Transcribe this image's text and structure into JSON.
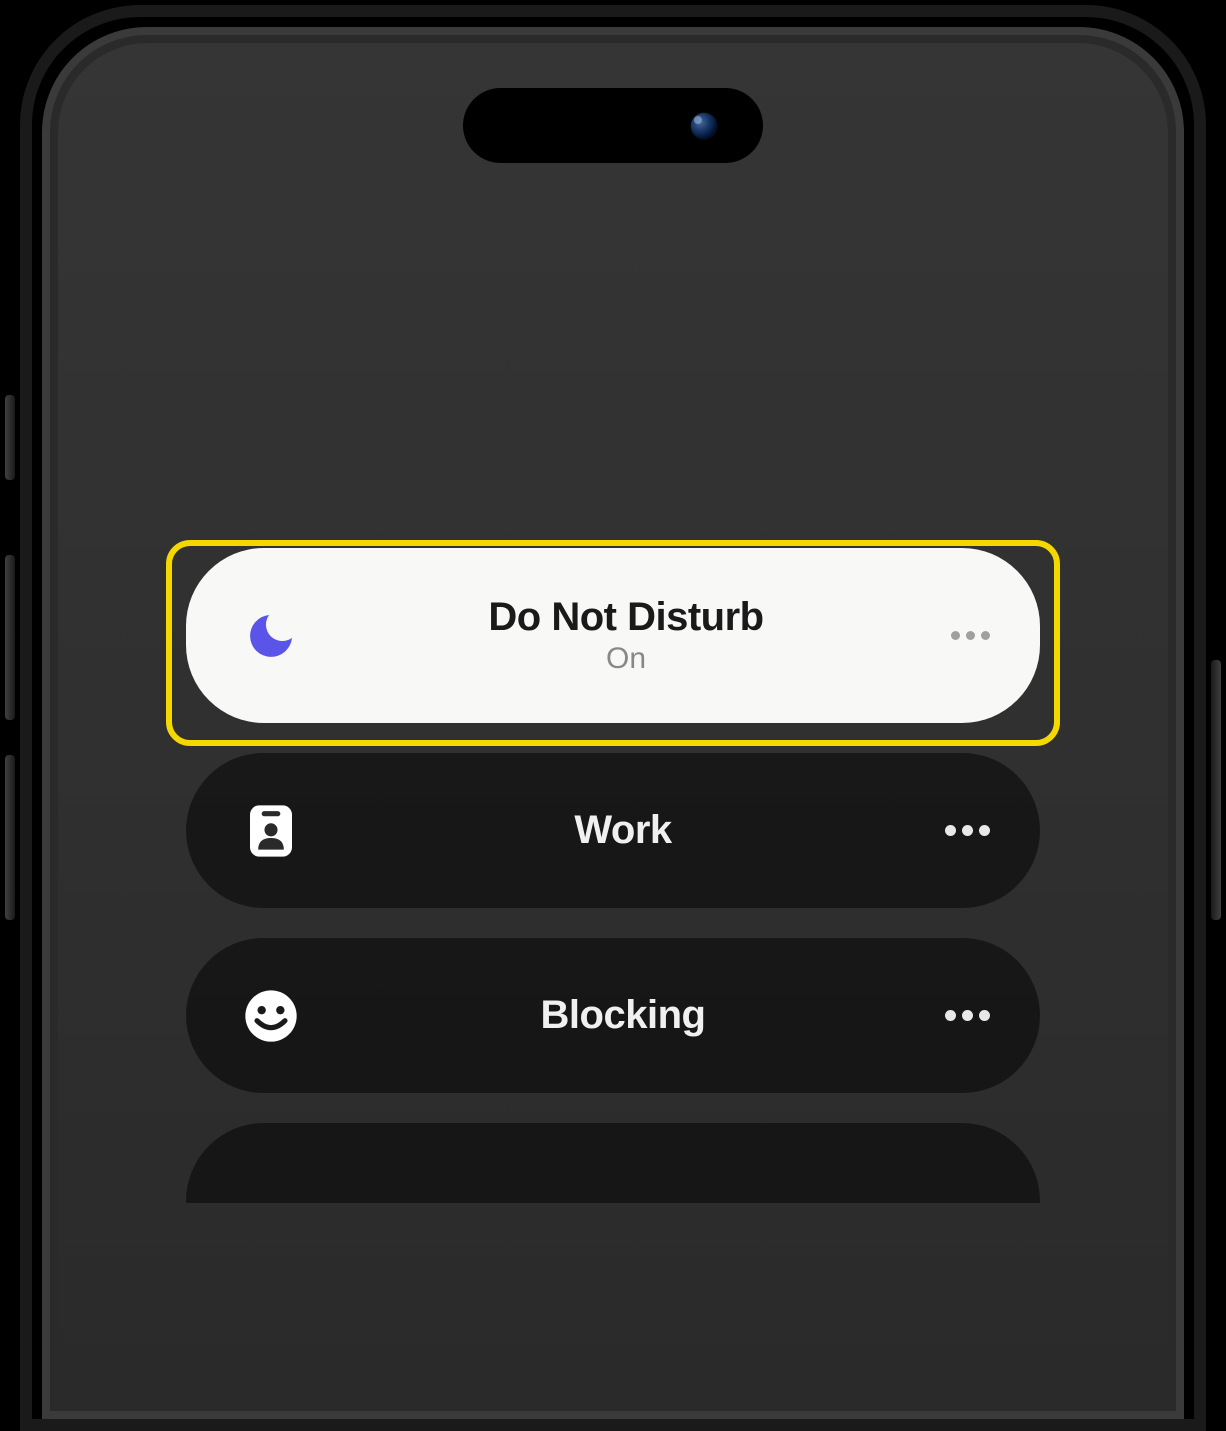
{
  "focus_modes": [
    {
      "title": "Do Not Disturb",
      "subtitle": "On",
      "icon": "moon",
      "active": true
    },
    {
      "title": "Work",
      "subtitle": "",
      "icon": "badge",
      "active": false
    },
    {
      "title": "Blocking",
      "subtitle": "",
      "icon": "smile",
      "active": false
    }
  ],
  "colors": {
    "moon_icon": "#5a55e8",
    "highlight": "#f5d800"
  }
}
